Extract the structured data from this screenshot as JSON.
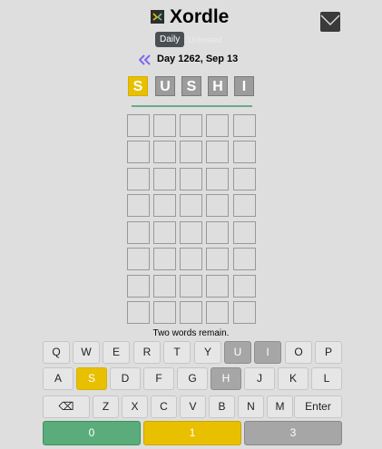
{
  "header": {
    "title": "Xordle",
    "logo_icon": "xordle-logo-icon",
    "menu_icon": "chevron-down-icon"
  },
  "modes": {
    "daily": "Daily",
    "unlimited": "Unlimited"
  },
  "day": {
    "back_icon": "double-chevron-left-icon",
    "label": "Day 1262, Sep 13"
  },
  "answer": {
    "letters": [
      "S",
      "U",
      "S",
      "H",
      "I"
    ],
    "states": [
      "yellow",
      "gray",
      "gray",
      "gray",
      "gray"
    ]
  },
  "board": {
    "rows": 8,
    "cols": 5
  },
  "status": "Two words remain.",
  "keyboard": {
    "row1": [
      "Q",
      "W",
      "E",
      "R",
      "T",
      "Y",
      "U",
      "I",
      "O",
      "P"
    ],
    "row2": [
      "A",
      "S",
      "D",
      "F",
      "G",
      "H",
      "J",
      "K",
      "L"
    ],
    "row3": [
      "⌫",
      "Z",
      "X",
      "C",
      "V",
      "B",
      "N",
      "M",
      "Enter"
    ],
    "key_states": {
      "U": "gray",
      "I": "gray",
      "S": "yellow",
      "H": "gray"
    }
  },
  "counts": [
    "0",
    "1",
    "3"
  ],
  "colors": {
    "yellow": "#e8c000",
    "gray": "#a6a6a6",
    "green": "#5aad7a",
    "background": "#dedede"
  }
}
